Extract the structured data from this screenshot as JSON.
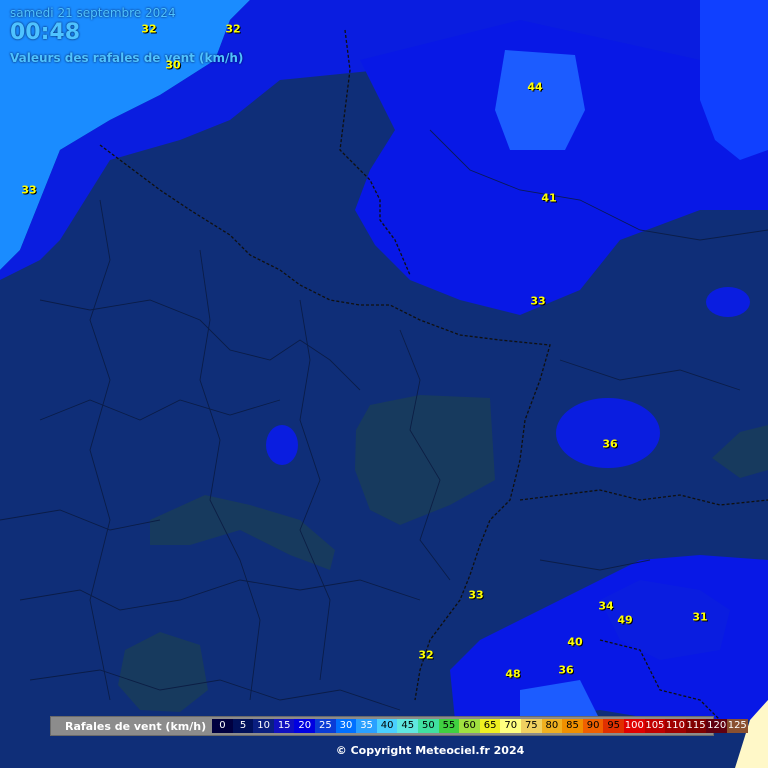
{
  "header": {
    "date": "samedi 21 septembre 2024",
    "time": "00:48",
    "subtitle": "Valeurs des rafales de vent (km/h)"
  },
  "map_values": [
    "32",
    "32",
    "30",
    "33",
    "44",
    "41",
    "33",
    "36",
    "33",
    "34",
    "49",
    "31",
    "40",
    "32",
    "48",
    "36"
  ],
  "legend": {
    "label": "Rafales de vent (km/h)",
    "items": [
      {
        "v": "0",
        "bg": "#000040",
        "fg": "#ffffff"
      },
      {
        "v": "5",
        "bg": "#00105a",
        "fg": "#ffffff"
      },
      {
        "v": "10",
        "bg": "#0a1f80",
        "fg": "#ffffff"
      },
      {
        "v": "15",
        "bg": "#1010c0",
        "fg": "#ffffff"
      },
      {
        "v": "20",
        "bg": "#0000e0",
        "fg": "#ffffff"
      },
      {
        "v": "25",
        "bg": "#0a3cd6",
        "fg": "#ffffff"
      },
      {
        "v": "30",
        "bg": "#0070ff",
        "fg": "#ffffff"
      },
      {
        "v": "35",
        "bg": "#2aa0ff",
        "fg": "#ffffff"
      },
      {
        "v": "40",
        "bg": "#4ad0ff",
        "fg": "#000000"
      },
      {
        "v": "45",
        "bg": "#60e8e0",
        "fg": "#000000"
      },
      {
        "v": "50",
        "bg": "#40e0a0",
        "fg": "#000000"
      },
      {
        "v": "55",
        "bg": "#40d040",
        "fg": "#000000"
      },
      {
        "v": "60",
        "bg": "#a0e040",
        "fg": "#000000"
      },
      {
        "v": "65",
        "bg": "#f0f020",
        "fg": "#000000"
      },
      {
        "v": "70",
        "bg": "#ffff80",
        "fg": "#000000"
      },
      {
        "v": "75",
        "bg": "#f0d060",
        "fg": "#000000"
      },
      {
        "v": "80",
        "bg": "#f0b020",
        "fg": "#000000"
      },
      {
        "v": "85",
        "bg": "#f09000",
        "fg": "#000000"
      },
      {
        "v": "90",
        "bg": "#f06000",
        "fg": "#000000"
      },
      {
        "v": "95",
        "bg": "#e03000",
        "fg": "#000000"
      },
      {
        "v": "100",
        "bg": "#e00000",
        "fg": "#ffffff"
      },
      {
        "v": "105",
        "bg": "#c00000",
        "fg": "#ffffff"
      },
      {
        "v": "110",
        "bg": "#a00000",
        "fg": "#ffffff"
      },
      {
        "v": "115",
        "bg": "#800000",
        "fg": "#ffffff"
      },
      {
        "v": "120",
        "bg": "#600010",
        "fg": "#ffffff"
      },
      {
        "v": "125",
        "bg": "#8a5030",
        "fg": "#ffffff"
      }
    ]
  },
  "copyright": "© Copyright Meteociel.fr 2024"
}
